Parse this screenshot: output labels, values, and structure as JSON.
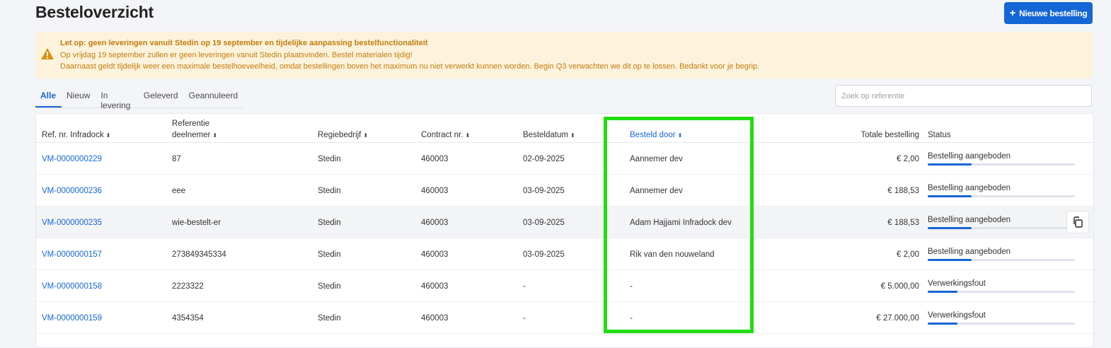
{
  "page": {
    "title": "Besteloverzicht"
  },
  "actions": {
    "new_order": "Nieuwe bestelling",
    "new_order_icon": "plus-icon"
  },
  "alert": {
    "title": "Let op: geen leveringen vanuit Stedin op 19 september en tijdelijke aanpassing bestelfunctionaliteit",
    "line1": "Op vrijdag 19 september zullen er geen leveringen vanuit Stedin plaatsvinden. Bestel materialen tijdig!",
    "line2": "Daarnaast geldt tijdelijk weer een maximale bestelhoeveelheid, omdat bestellingen boven het maximum nu niet verwerkt kunnen worden. Begin Q3 verwachten we dit op te lossen. Bedankt voor je begrip.",
    "icon": "warning-icon",
    "color": "#c27c0e"
  },
  "tabs": [
    {
      "label": "Alle",
      "active": true
    },
    {
      "label": "Nieuw",
      "active": false
    },
    {
      "label": "In levering",
      "active": false
    },
    {
      "label": "Geleverd",
      "active": false
    },
    {
      "label": "Geannuleerd",
      "active": false
    }
  ],
  "search": {
    "placeholder": "Zoek op referentie",
    "value": ""
  },
  "table": {
    "columns": {
      "ref": "Ref. nr. Infradock",
      "deelnemer_1": "Referentie",
      "deelnemer_2": "deelnemer",
      "regie": "Regiebedrijf",
      "contract": "Contract nr.",
      "datum": "Besteldatum",
      "door": "Besteld door",
      "totaal": "Totale bestelling",
      "status": "Status"
    },
    "rows": [
      {
        "ref": "VM-0000000229",
        "deelnemer": "87",
        "regie": "Stedin",
        "contract": "460003",
        "datum": "02-09-2025",
        "door": "Aannemer dev",
        "totaal": "€ 2,00",
        "status": "Bestelling aangeboden",
        "progress": 0.3
      },
      {
        "ref": "VM-0000000236",
        "deelnemer": "eee",
        "regie": "Stedin",
        "contract": "460003",
        "datum": "03-09-2025",
        "door": "Aannemer dev",
        "totaal": "€ 188,53",
        "status": "Bestelling aangeboden",
        "progress": 0.3
      },
      {
        "ref": "VM-0000000235",
        "deelnemer": "wie-bestelt-er",
        "regie": "Stedin",
        "contract": "460003",
        "datum": "03-09-2025",
        "door": "Adam Hajjami Infradock dev",
        "totaal": "€ 188,53",
        "status": "Bestelling aangeboden",
        "progress": 0.3
      },
      {
        "ref": "VM-0000000157",
        "deelnemer": "273849345334",
        "regie": "Stedin",
        "contract": "460003",
        "datum": "03-09-2025",
        "door": "Rik van den nouweland",
        "totaal": "€ 2,00",
        "status": "Bestelling aangeboden",
        "progress": 0.3
      },
      {
        "ref": "VM-0000000158",
        "deelnemer": "2223322",
        "regie": "Stedin",
        "contract": "460003",
        "datum": "-",
        "door": "-",
        "totaal": "€ 5.000,00",
        "status": "Verwerkingsfout",
        "progress": 0.2
      },
      {
        "ref": "VM-0000000159",
        "deelnemer": "4354354",
        "regie": "Stedin",
        "contract": "460003",
        "datum": "-",
        "door": "-",
        "totaal": "€ 27.000,00",
        "status": "Verwerkingsfout",
        "progress": 0.2
      }
    ],
    "hover_row_action": "copy-icon"
  },
  "colors": {
    "accent": "#1566d6",
    "highlight": "#22dd11",
    "alert_bg": "#fdf3dc"
  }
}
